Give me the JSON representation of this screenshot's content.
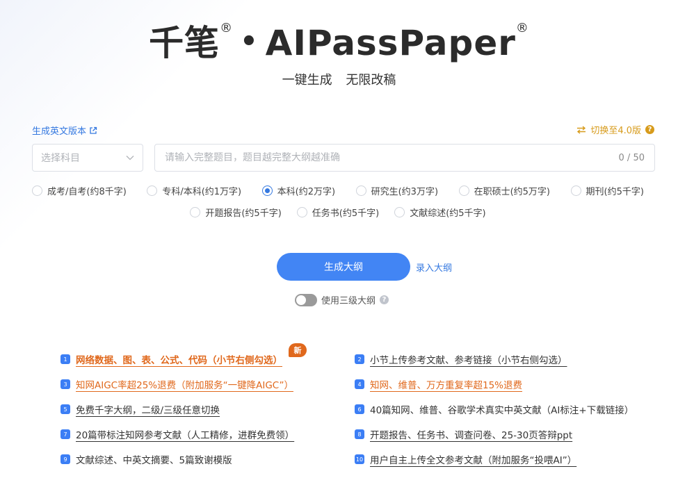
{
  "header": {
    "brand_cn": "千笔",
    "reg": "®",
    "dot": "•",
    "brand_en": "AIPassPaper",
    "subtitle": "一键生成 无限改稿"
  },
  "links": {
    "english_version": "生成英文版本",
    "switch_version": "切换至4.0版"
  },
  "form": {
    "subject_placeholder": "选择科目",
    "topic_placeholder": "请输入完整题目，题目越完整大纲越准确",
    "counter": "0 / 50"
  },
  "degree_options_row1": [
    {
      "label": "成考/自考(约8千字)",
      "checked": false
    },
    {
      "label": "专科/本科(约1万字)",
      "checked": false
    },
    {
      "label": "本科(约2万字)",
      "checked": true
    },
    {
      "label": "研究生(约3万字)",
      "checked": false
    },
    {
      "label": "在职硕士(约5万字)",
      "checked": false
    },
    {
      "label": "期刊(约5千字)",
      "checked": false
    }
  ],
  "degree_options_row2": [
    {
      "label": "开题报告(约5千字)",
      "checked": false
    },
    {
      "label": "任务书(约5千字)",
      "checked": false
    },
    {
      "label": "文献综述(约5千字)",
      "checked": false
    }
  ],
  "actions": {
    "generate": "生成大纲",
    "import": "录入大纲",
    "three_level_label": "使用三级大纲"
  },
  "badge": "新",
  "features": [
    {
      "num": "1",
      "text": "网络数据、图、表、公式、代码（小节右侧勾选）",
      "color": "orange",
      "bold": true
    },
    {
      "num": "2",
      "text": "小节上传参考文献、参考链接（小节右侧勾选）",
      "color": "dark",
      "bold": false
    },
    {
      "num": "3",
      "text": "知网AIGC率超25%退费（附加服务“一键降AIGC”）",
      "color": "orange",
      "bold": false
    },
    {
      "num": "4",
      "text": "知网、维普、万方重复率超15%退费",
      "color": "orange",
      "bold": false
    },
    {
      "num": "5",
      "text": "免费千字大纲，二级/三级任意切换",
      "color": "dark",
      "bold": false
    },
    {
      "num": "6",
      "text": "40篇知网、维普、谷歌学术真实中英文献（AI标注+下载链接）",
      "color": "dark",
      "bold": false
    },
    {
      "num": "7",
      "text": "20篇带标注知网参考文献（人工精修，进群免费领）",
      "color": "dark",
      "bold": false
    },
    {
      "num": "8",
      "text": "开题报告、任务书、调查问卷、25-30页答辩ppt",
      "color": "dark",
      "bold": false
    },
    {
      "num": "9",
      "text": "文献综述、中英文摘要、5篇致谢模版",
      "color": "dark",
      "bold": false
    },
    {
      "num": "10",
      "text": "用户自主上传全文参考文献（附加服务“投喂AI”）",
      "color": "dark",
      "bold": false
    }
  ],
  "colors": {
    "primary": "#4285f4",
    "link": "#3478e0",
    "accent_orange": "#e0681c",
    "gold": "#d79b1b"
  }
}
